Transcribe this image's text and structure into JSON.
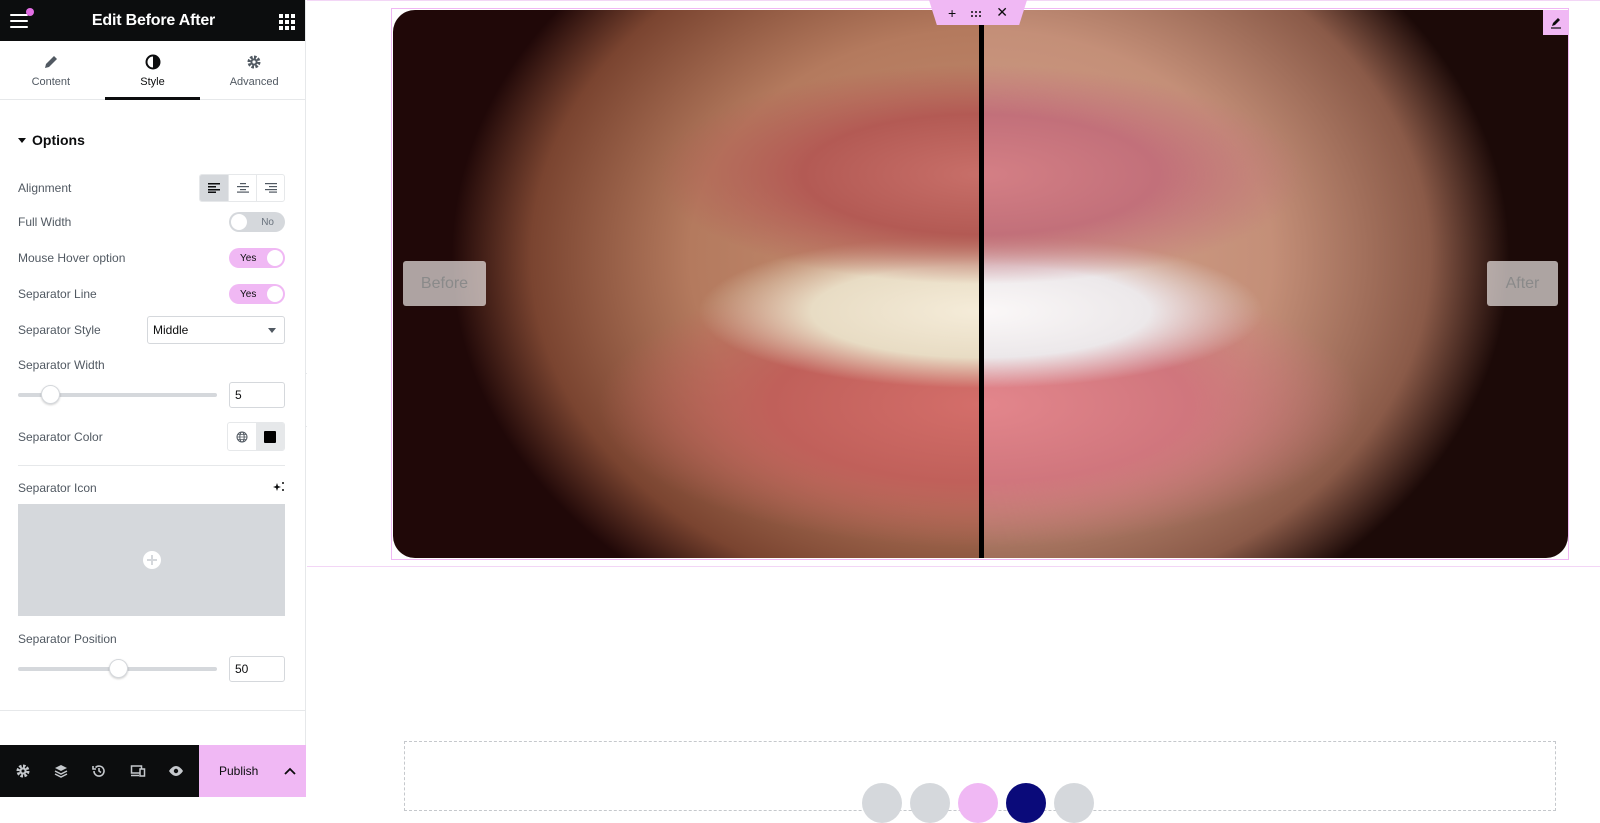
{
  "header": {
    "title": "Edit Before After",
    "menu_icon": "hamburger-icon",
    "apps_icon": "grid-icon"
  },
  "tabs": [
    {
      "label": "Content",
      "icon": "pencil-icon",
      "active": false
    },
    {
      "label": "Style",
      "icon": "contrast-icon",
      "active": true
    },
    {
      "label": "Advanced",
      "icon": "gear-icon",
      "active": false
    }
  ],
  "section": {
    "title": "Options"
  },
  "controls": {
    "alignment": {
      "label": "Alignment",
      "options": [
        "left",
        "center",
        "right"
      ],
      "selected": "left"
    },
    "full_width": {
      "label": "Full Width",
      "value": "No"
    },
    "mouse_hover": {
      "label": "Mouse Hover option",
      "value": "Yes"
    },
    "separator_line": {
      "label": "Separator Line",
      "value": "Yes"
    },
    "separator_style": {
      "label": "Separator Style",
      "value": "Middle"
    },
    "separator_width": {
      "label": "Separator Width",
      "value": "5",
      "slider_fraction": 0.05
    },
    "separator_color": {
      "label": "Separator Color",
      "value": "#000000"
    },
    "separator_icon": {
      "label": "Separator Icon"
    },
    "separator_position": {
      "label": "Separator Position",
      "value": "50",
      "slider_fraction": 0.5
    }
  },
  "footer": {
    "publish_label": "Publish"
  },
  "canvas": {
    "before_label": "Before",
    "after_label": "After",
    "separator_position_percent": 50,
    "colors": {
      "accent": "#f0b8f4",
      "dark": "#0c0d0e"
    }
  }
}
